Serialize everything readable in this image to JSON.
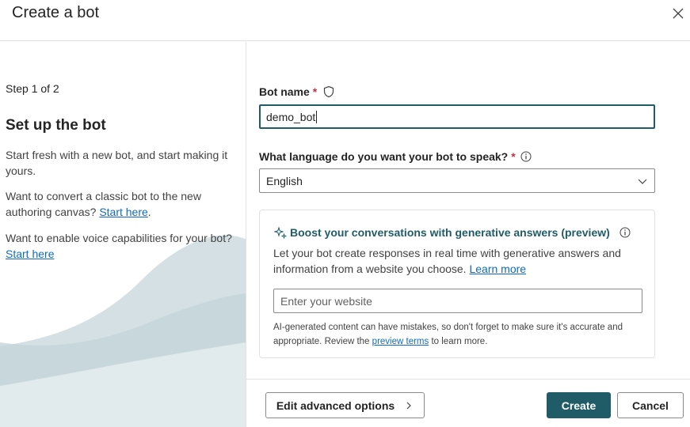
{
  "dialog": {
    "title": "Create a bot"
  },
  "left": {
    "step": "Step 1 of 2",
    "heading": "Set up the bot",
    "para1": "Start fresh with a new bot, and start making it yours.",
    "para2_text": "Want to convert a classic bot to the new authoring canvas?",
    "para2_link": "Start here",
    "para2_suffix": ".",
    "para3_text": "Want to enable voice capabilities for your bot?",
    "para3_link": "Start here"
  },
  "form": {
    "bot_name_label": "Bot name",
    "required_mark": "*",
    "bot_name_value": "demo_bot",
    "language_label": "What language do you want your bot to speak?",
    "language_value": "English"
  },
  "generative": {
    "title": "Boost your conversations with generative answers (preview)",
    "description": "Let your bot create responses in real time with generative answers and information from a website you choose.",
    "learn_more": "Learn more",
    "website_placeholder": "Enter your website",
    "disclaimer_prefix": "AI-generated content can have mistakes, so don't forget to make sure it's accurate and appropriate. Review the",
    "disclaimer_link": "preview terms",
    "disclaimer_suffix": "to learn more."
  },
  "footer": {
    "advanced_label": "Edit advanced options",
    "create_label": "Create",
    "cancel_label": "Cancel"
  },
  "colors": {
    "accent": "#1f5c68",
    "link": "#0f6cbd",
    "required": "#c4314b"
  },
  "icons": {
    "close": "close-icon",
    "shield": "shield-icon",
    "info": "info-icon",
    "chevron_down": "chevron-down-icon",
    "sparkle": "sparkle-icon",
    "chevron_right": "chevron-right-icon"
  }
}
